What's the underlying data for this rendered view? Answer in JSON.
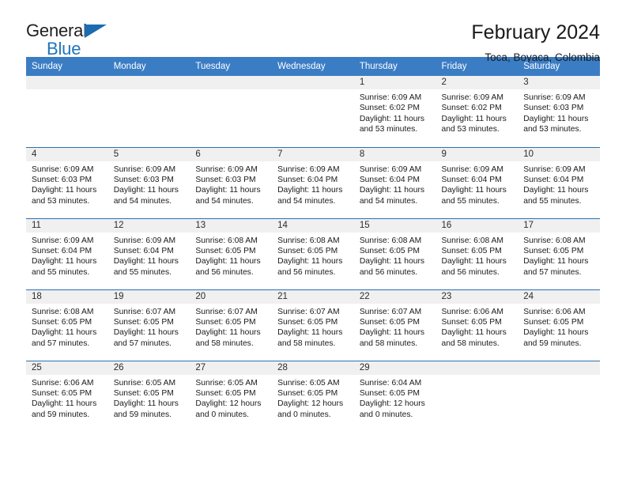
{
  "logo": {
    "text_primary": "General",
    "text_secondary": "Blue",
    "triangle_color": "#1b6cb0",
    "secondary_color": "#1f74bd"
  },
  "header": {
    "title": "February 2024",
    "subtitle": "Toca, Boyaca, Colombia"
  },
  "theme": {
    "header_bg": "#3b7dc4",
    "row_divider": "#2a6fb4",
    "daynum_band_bg": "#f0f0f0"
  },
  "weekdays": [
    "Sunday",
    "Monday",
    "Tuesday",
    "Wednesday",
    "Thursday",
    "Friday",
    "Saturday"
  ],
  "weeks": [
    [
      {
        "day": "",
        "lines": []
      },
      {
        "day": "",
        "lines": []
      },
      {
        "day": "",
        "lines": []
      },
      {
        "day": "",
        "lines": []
      },
      {
        "day": "1",
        "lines": [
          "Sunrise: 6:09 AM",
          "Sunset: 6:02 PM",
          "Daylight: 11 hours",
          "and 53 minutes."
        ]
      },
      {
        "day": "2",
        "lines": [
          "Sunrise: 6:09 AM",
          "Sunset: 6:02 PM",
          "Daylight: 11 hours",
          "and 53 minutes."
        ]
      },
      {
        "day": "3",
        "lines": [
          "Sunrise: 6:09 AM",
          "Sunset: 6:03 PM",
          "Daylight: 11 hours",
          "and 53 minutes."
        ]
      }
    ],
    [
      {
        "day": "4",
        "lines": [
          "Sunrise: 6:09 AM",
          "Sunset: 6:03 PM",
          "Daylight: 11 hours",
          "and 53 minutes."
        ]
      },
      {
        "day": "5",
        "lines": [
          "Sunrise: 6:09 AM",
          "Sunset: 6:03 PM",
          "Daylight: 11 hours",
          "and 54 minutes."
        ]
      },
      {
        "day": "6",
        "lines": [
          "Sunrise: 6:09 AM",
          "Sunset: 6:03 PM",
          "Daylight: 11 hours",
          "and 54 minutes."
        ]
      },
      {
        "day": "7",
        "lines": [
          "Sunrise: 6:09 AM",
          "Sunset: 6:04 PM",
          "Daylight: 11 hours",
          "and 54 minutes."
        ]
      },
      {
        "day": "8",
        "lines": [
          "Sunrise: 6:09 AM",
          "Sunset: 6:04 PM",
          "Daylight: 11 hours",
          "and 54 minutes."
        ]
      },
      {
        "day": "9",
        "lines": [
          "Sunrise: 6:09 AM",
          "Sunset: 6:04 PM",
          "Daylight: 11 hours",
          "and 55 minutes."
        ]
      },
      {
        "day": "10",
        "lines": [
          "Sunrise: 6:09 AM",
          "Sunset: 6:04 PM",
          "Daylight: 11 hours",
          "and 55 minutes."
        ]
      }
    ],
    [
      {
        "day": "11",
        "lines": [
          "Sunrise: 6:09 AM",
          "Sunset: 6:04 PM",
          "Daylight: 11 hours",
          "and 55 minutes."
        ]
      },
      {
        "day": "12",
        "lines": [
          "Sunrise: 6:09 AM",
          "Sunset: 6:04 PM",
          "Daylight: 11 hours",
          "and 55 minutes."
        ]
      },
      {
        "day": "13",
        "lines": [
          "Sunrise: 6:08 AM",
          "Sunset: 6:05 PM",
          "Daylight: 11 hours",
          "and 56 minutes."
        ]
      },
      {
        "day": "14",
        "lines": [
          "Sunrise: 6:08 AM",
          "Sunset: 6:05 PM",
          "Daylight: 11 hours",
          "and 56 minutes."
        ]
      },
      {
        "day": "15",
        "lines": [
          "Sunrise: 6:08 AM",
          "Sunset: 6:05 PM",
          "Daylight: 11 hours",
          "and 56 minutes."
        ]
      },
      {
        "day": "16",
        "lines": [
          "Sunrise: 6:08 AM",
          "Sunset: 6:05 PM",
          "Daylight: 11 hours",
          "and 56 minutes."
        ]
      },
      {
        "day": "17",
        "lines": [
          "Sunrise: 6:08 AM",
          "Sunset: 6:05 PM",
          "Daylight: 11 hours",
          "and 57 minutes."
        ]
      }
    ],
    [
      {
        "day": "18",
        "lines": [
          "Sunrise: 6:08 AM",
          "Sunset: 6:05 PM",
          "Daylight: 11 hours",
          "and 57 minutes."
        ]
      },
      {
        "day": "19",
        "lines": [
          "Sunrise: 6:07 AM",
          "Sunset: 6:05 PM",
          "Daylight: 11 hours",
          "and 57 minutes."
        ]
      },
      {
        "day": "20",
        "lines": [
          "Sunrise: 6:07 AM",
          "Sunset: 6:05 PM",
          "Daylight: 11 hours",
          "and 58 minutes."
        ]
      },
      {
        "day": "21",
        "lines": [
          "Sunrise: 6:07 AM",
          "Sunset: 6:05 PM",
          "Daylight: 11 hours",
          "and 58 minutes."
        ]
      },
      {
        "day": "22",
        "lines": [
          "Sunrise: 6:07 AM",
          "Sunset: 6:05 PM",
          "Daylight: 11 hours",
          "and 58 minutes."
        ]
      },
      {
        "day": "23",
        "lines": [
          "Sunrise: 6:06 AM",
          "Sunset: 6:05 PM",
          "Daylight: 11 hours",
          "and 58 minutes."
        ]
      },
      {
        "day": "24",
        "lines": [
          "Sunrise: 6:06 AM",
          "Sunset: 6:05 PM",
          "Daylight: 11 hours",
          "and 59 minutes."
        ]
      }
    ],
    [
      {
        "day": "25",
        "lines": [
          "Sunrise: 6:06 AM",
          "Sunset: 6:05 PM",
          "Daylight: 11 hours",
          "and 59 minutes."
        ]
      },
      {
        "day": "26",
        "lines": [
          "Sunrise: 6:05 AM",
          "Sunset: 6:05 PM",
          "Daylight: 11 hours",
          "and 59 minutes."
        ]
      },
      {
        "day": "27",
        "lines": [
          "Sunrise: 6:05 AM",
          "Sunset: 6:05 PM",
          "Daylight: 12 hours",
          "and 0 minutes."
        ]
      },
      {
        "day": "28",
        "lines": [
          "Sunrise: 6:05 AM",
          "Sunset: 6:05 PM",
          "Daylight: 12 hours",
          "and 0 minutes."
        ]
      },
      {
        "day": "29",
        "lines": [
          "Sunrise: 6:04 AM",
          "Sunset: 6:05 PM",
          "Daylight: 12 hours",
          "and 0 minutes."
        ]
      },
      {
        "day": "",
        "lines": []
      },
      {
        "day": "",
        "lines": []
      }
    ]
  ]
}
